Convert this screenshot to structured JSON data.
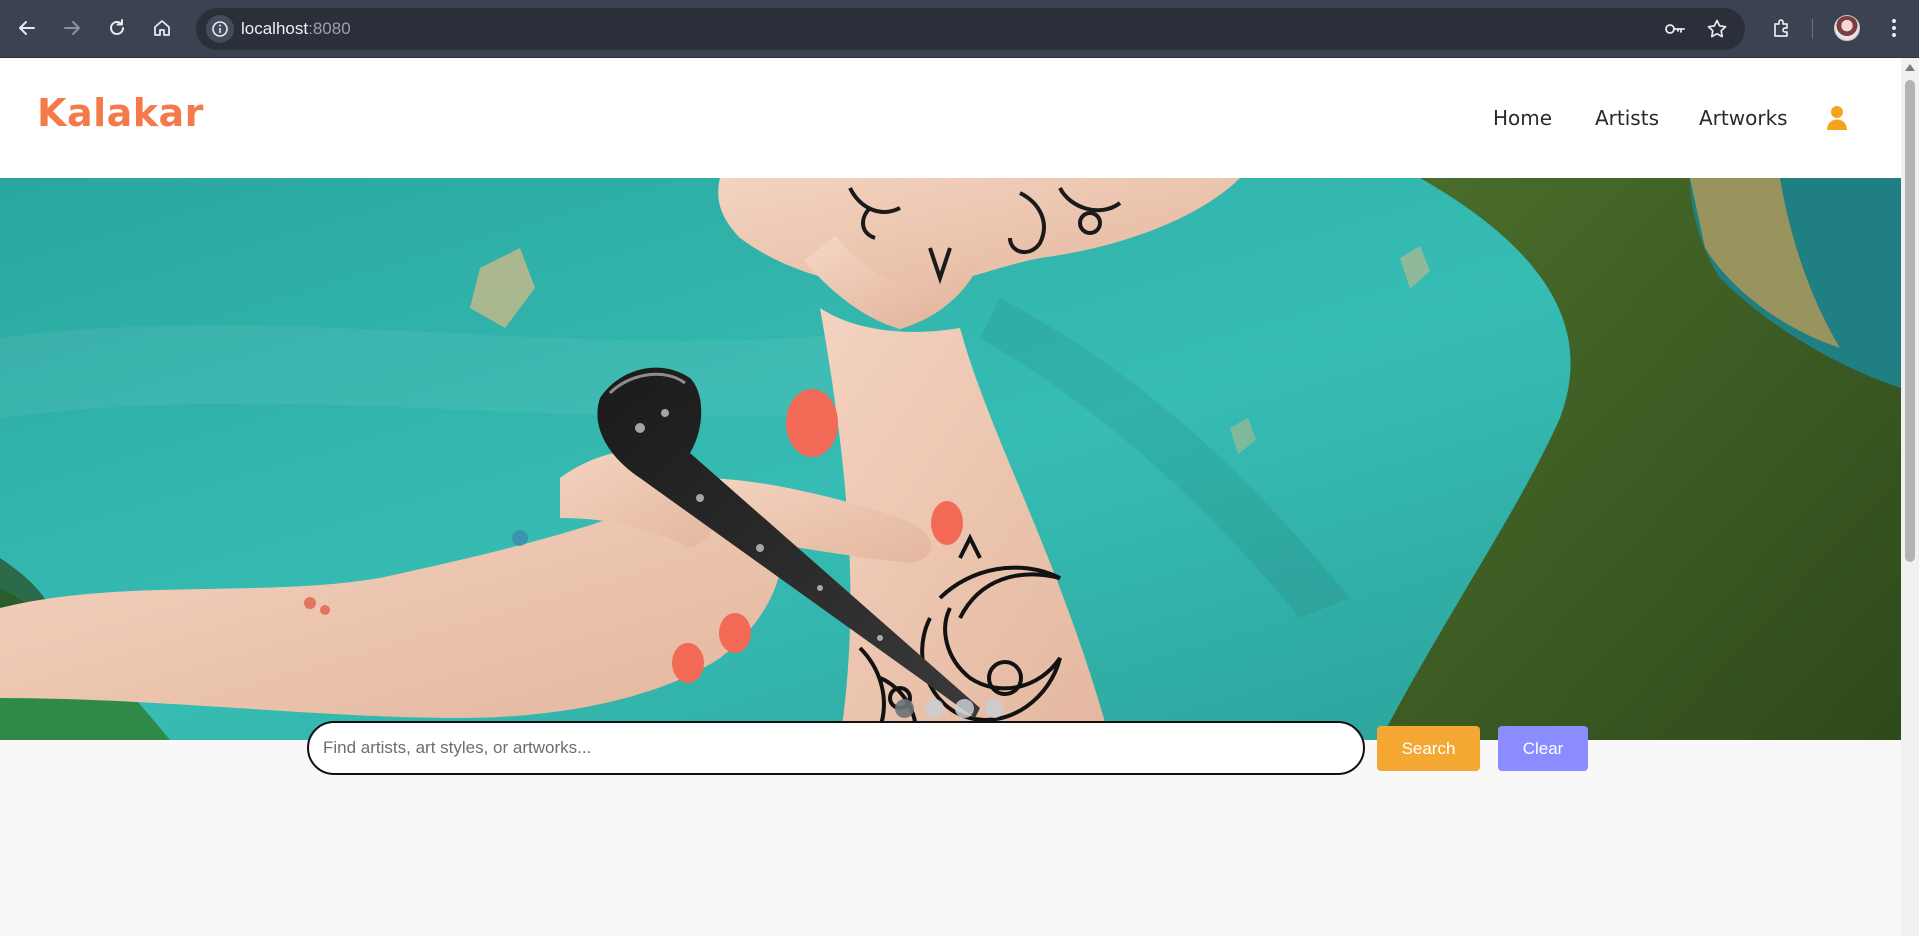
{
  "browser": {
    "url_host": "localhost",
    "url_port": ":8080",
    "icons": {
      "back": "arrow-left-icon",
      "forward": "arrow-right-icon",
      "reload": "reload-icon",
      "home": "home-icon",
      "site_info": "info-icon",
      "password": "key-icon",
      "bookmark": "star-icon",
      "extensions": "puzzle-icon",
      "menu": "kebab-menu-icon"
    }
  },
  "header": {
    "brand": "Kalakar",
    "nav": [
      {
        "label": "Home"
      },
      {
        "label": "Artists"
      },
      {
        "label": "Artworks"
      }
    ],
    "user_icon": "user-icon"
  },
  "hero": {
    "slide_count": 4,
    "active_slide": 0
  },
  "search": {
    "placeholder": "Find artists, art styles, or artworks...",
    "value": "",
    "search_label": "Search",
    "clear_label": "Clear"
  },
  "colors": {
    "brand": "#f47a4a",
    "user_icon": "#f5a31a",
    "search_button": "#f5a733",
    "clear_button": "#8b8cff",
    "chrome_bg": "#3b4252"
  }
}
